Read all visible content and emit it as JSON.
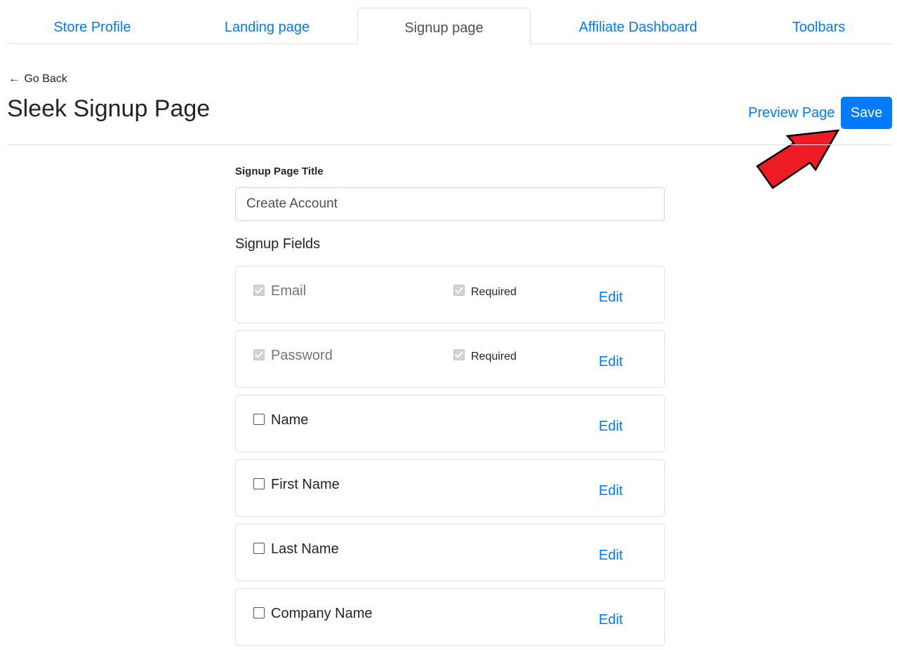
{
  "tabs": [
    {
      "label": "Store Profile"
    },
    {
      "label": "Landing page"
    },
    {
      "label": "Signup page",
      "active": true
    },
    {
      "label": "Affiliate Dashboard"
    },
    {
      "label": "Toolbars"
    }
  ],
  "header": {
    "go_back": "Go Back",
    "title": "Sleek Signup Page",
    "preview_label": "Preview Page",
    "save_label": "Save"
  },
  "form": {
    "title_label": "Signup Page Title",
    "title_value": "Create Account",
    "fields_heading": "Signup Fields",
    "required_label": "Required",
    "edit_label": "Edit",
    "fields": [
      {
        "name": "Email",
        "checked": true,
        "disabled": true,
        "required": true
      },
      {
        "name": "Password",
        "checked": true,
        "disabled": true,
        "required": true
      },
      {
        "name": "Name",
        "checked": false,
        "disabled": false,
        "required": false
      },
      {
        "name": "First Name",
        "checked": false,
        "disabled": false,
        "required": false
      },
      {
        "name": "Last Name",
        "checked": false,
        "disabled": false,
        "required": false
      },
      {
        "name": "Company Name",
        "checked": false,
        "disabled": false,
        "required": false
      }
    ]
  },
  "colors": {
    "accent": "#007bff",
    "annotation_arrow": "#ed1c24"
  }
}
